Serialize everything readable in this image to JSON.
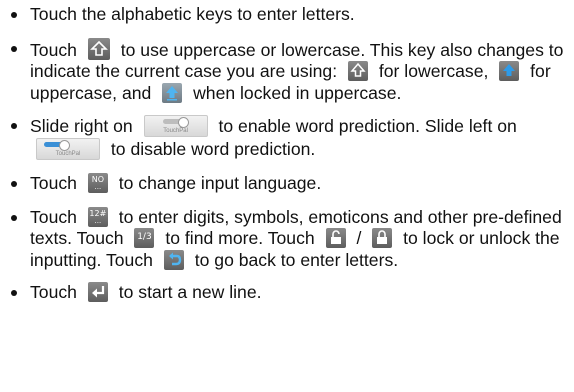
{
  "bullets": [
    {
      "text": "Touch the alphabetic keys to enter letters."
    },
    {
      "t1": "Touch",
      "t2": "to use uppercase or lowercase. This key also changes to indicate the current case you are using:",
      "t3": "for lowercase,",
      "t4": "for uppercase, and",
      "t5": "when locked in uppercase."
    },
    {
      "t1": "Slide right on",
      "t2": "to enable word prediction. Slide left on",
      "t3": "to disable word prediction.",
      "pill_label": "TouchPal"
    },
    {
      "t1": "Touch",
      "t2": "to change input language.",
      "key_top": "NO",
      "key_bottom": "..."
    },
    {
      "t1": "Touch",
      "t2": "to enter digits, symbols, emoticons and other pre-defined texts. Touch",
      "t3": "to find more. Touch",
      "t4": "/",
      "t5": "to lock or unlock the inputting. Touch",
      "t6": "to go back to enter letters.",
      "key_digits": "12#",
      "key_digits_sub": "...",
      "key_page": "1/3"
    },
    {
      "t1": "Touch",
      "t2": "to start a new line."
    }
  ]
}
